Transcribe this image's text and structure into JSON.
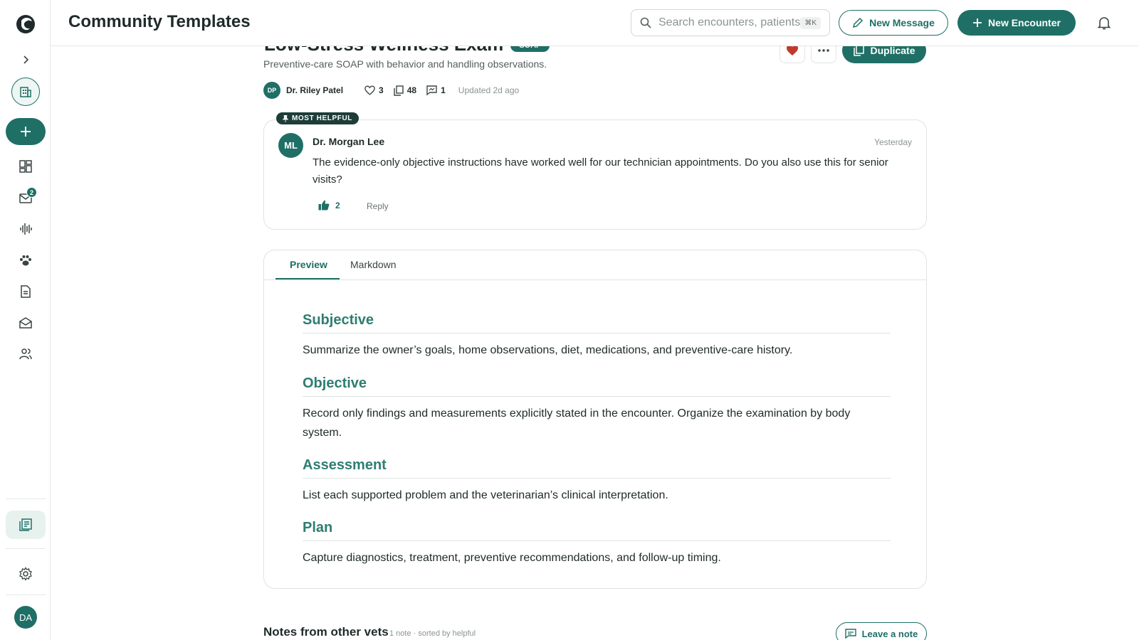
{
  "header": {
    "title": "Community Templates",
    "search_placeholder": "Search encounters, patients...",
    "search_shortcut": "⌘K",
    "new_message_label": "New Message",
    "new_encounter_label": "New Encounter"
  },
  "sidebar": {
    "inbox_badge": "2",
    "user_initials": "DA"
  },
  "template": {
    "title": "Low-Stress Wellness Exam",
    "badge": "SOAP",
    "description": "Preventive-care SOAP with behavior and handling observations.",
    "author_initials": "DP",
    "author": "Dr. Riley Patel",
    "likes": "3",
    "copies": "48",
    "comments": "1",
    "updated": "Updated 2d ago",
    "duplicate_label": "Duplicate"
  },
  "comment": {
    "pin_label": "MOST HELPFUL",
    "initials": "ML",
    "author": "Dr. Morgan Lee",
    "time": "Yesterday",
    "body": "The evidence-only objective instructions have worked well for our technician appointments. Do you also use this for senior visits?",
    "likes": "2",
    "reply_label": "Reply"
  },
  "editor": {
    "tabs": [
      "Preview",
      "Markdown"
    ],
    "sections": [
      {
        "heading": "Subjective",
        "text": "Summarize the owner’s goals, home observations, diet, medications, and preventive-care history."
      },
      {
        "heading": "Objective",
        "text": "Record only findings and measurements explicitly stated in the encounter. Organize the examination by body system."
      },
      {
        "heading": "Assessment",
        "text": "List each supported problem and the veterinarian’s clinical interpretation."
      },
      {
        "heading": "Plan",
        "text": "Capture diagnostics, treatment, preventive recommendations, and follow-up timing."
      }
    ]
  },
  "notes": {
    "title": "Notes from other vets",
    "subtitle": "1 note · sorted by helpful",
    "leave_label": "Leave a note"
  },
  "colors": {
    "accent": "#1f6f66",
    "heading": "#2f7d72",
    "heart": "#c0392b"
  }
}
